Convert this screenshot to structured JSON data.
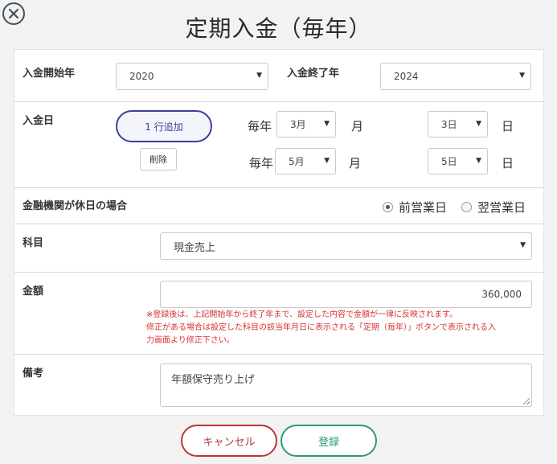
{
  "header": {
    "title": "定期入金（毎年）",
    "close_icon": "close-circle-icon"
  },
  "year_range": {
    "start_label": "入金開始年",
    "start_value": "2020",
    "end_label": "入金終了年",
    "end_value": "2024"
  },
  "payment_day": {
    "label": "入金日",
    "add_row_label": "1 行追加",
    "delete_label": "削除",
    "rows": [
      {
        "prefix": "毎年",
        "month": "3月",
        "month_suffix": "月",
        "day": "3日",
        "day_suffix": "日"
      },
      {
        "prefix": "毎年",
        "month": "5月",
        "month_suffix": "月",
        "day": "5日",
        "day_suffix": "日"
      }
    ]
  },
  "holiday": {
    "label": "金融機関が休日の場合",
    "options": [
      {
        "label": "前営業日",
        "checked": true
      },
      {
        "label": "翌営業日",
        "checked": false
      }
    ]
  },
  "account": {
    "label": "科目",
    "value": "現金売上"
  },
  "amount": {
    "label": "金額",
    "value": "360,000",
    "note_line1": "※登録後は、上記開始年から終了年まで、設定した内容で金額が一律に反映されます。",
    "note_line2": "修正がある場合は設定した科目の該当年月日に表示される「定期（毎年）」ボタンで表示される入",
    "note_line3": "力画面より修正下さい。"
  },
  "memo": {
    "label": "備考",
    "value": "年額保守売り上げ"
  },
  "footer": {
    "cancel_label": "キャンセル",
    "register_label": "登録"
  }
}
